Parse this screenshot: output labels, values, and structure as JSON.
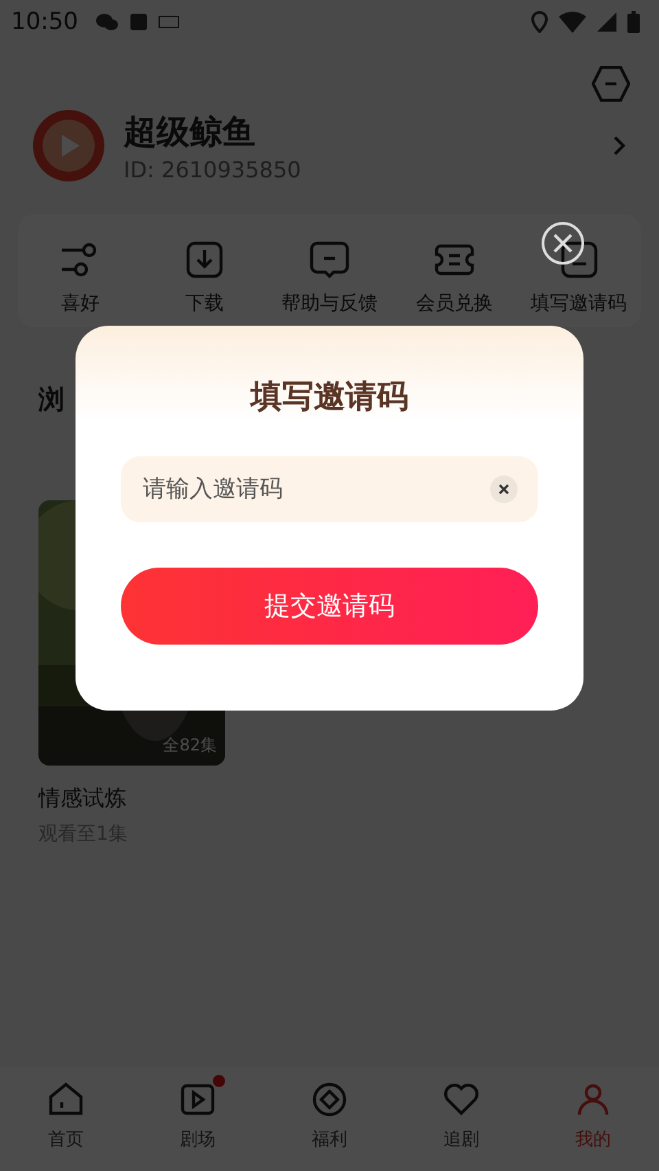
{
  "status_bar": {
    "time": "10:50"
  },
  "profile": {
    "name": "超级鲸鱼",
    "id": "ID: 2610935850"
  },
  "shortcuts": [
    {
      "kind": "sliders",
      "label": "喜好"
    },
    {
      "kind": "download",
      "label": "下载"
    },
    {
      "kind": "chat",
      "label": "帮助与反馈"
    },
    {
      "kind": "ticket",
      "label": "会员兑换"
    },
    {
      "kind": "invite",
      "label": "填写邀请码"
    }
  ],
  "history": {
    "title": "浏",
    "items": [
      {
        "badge": "全82集",
        "title": "情感试炼",
        "progress": "观看至1集"
      }
    ]
  },
  "dialog": {
    "title": "填写邀请码",
    "placeholder": "请输入邀请码",
    "submit": "提交邀请码"
  },
  "nav": [
    {
      "kind": "home",
      "label": "首页",
      "selected": false,
      "dot": false
    },
    {
      "kind": "play",
      "label": "剧场",
      "selected": false,
      "dot": true
    },
    {
      "kind": "coin",
      "label": "福利",
      "selected": false,
      "dot": false
    },
    {
      "kind": "heart",
      "label": "追剧",
      "selected": false,
      "dot": false
    },
    {
      "kind": "user",
      "label": "我的",
      "selected": true,
      "dot": false
    }
  ]
}
